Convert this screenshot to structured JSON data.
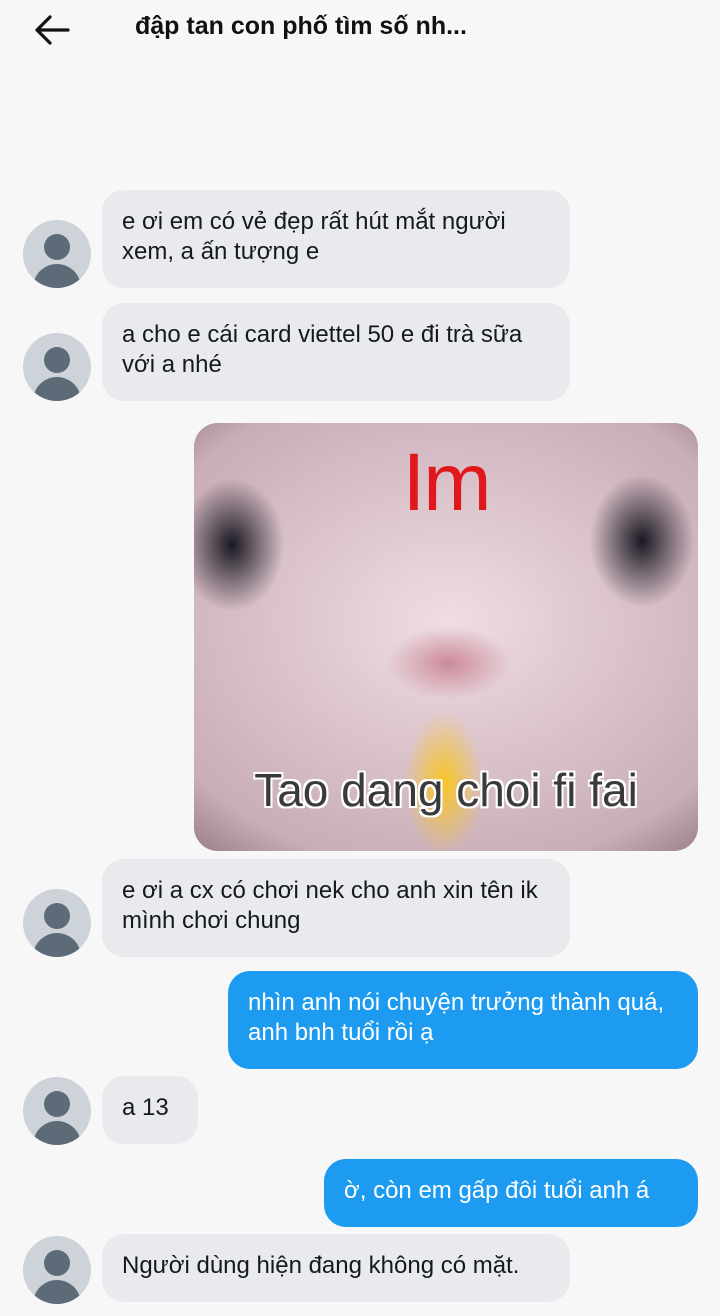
{
  "header": {
    "back_icon": "arrow-left-icon",
    "title": "đập tan con phố tìm số nh..."
  },
  "messages": [
    {
      "direction": "incoming",
      "text": "e ơi em có vẻ đẹp rất hút mắt người xem, a ấn tượng e"
    },
    {
      "direction": "incoming",
      "text": "a cho e cái card viettel 50 e đi trà sữa với a nhé"
    },
    {
      "direction": "outgoing",
      "type": "image",
      "top_text": "Im",
      "bottom_text": "Tao dang choi fi fai"
    },
    {
      "direction": "incoming",
      "text": "e ơi a cx có chơi nek cho anh xin tên ik mình chơi chung"
    },
    {
      "direction": "outgoing",
      "text": "nhìn anh nói chuyện trưởng thành quá, anh bnh tuổi rồi ạ"
    },
    {
      "direction": "incoming",
      "text": "a 13"
    },
    {
      "direction": "outgoing",
      "text": "ờ, còn em gấp đôi tuổi anh á"
    },
    {
      "direction": "incoming",
      "text": "Người dùng hiện đang không có mặt."
    }
  ],
  "colors": {
    "outgoing_bubble": "#1d9bf0",
    "incoming_bubble": "#e8eaed",
    "background": "#f7f7f7",
    "meme_top_text": "#e0181c"
  },
  "icons": {
    "avatar": "default-avatar-icon"
  }
}
